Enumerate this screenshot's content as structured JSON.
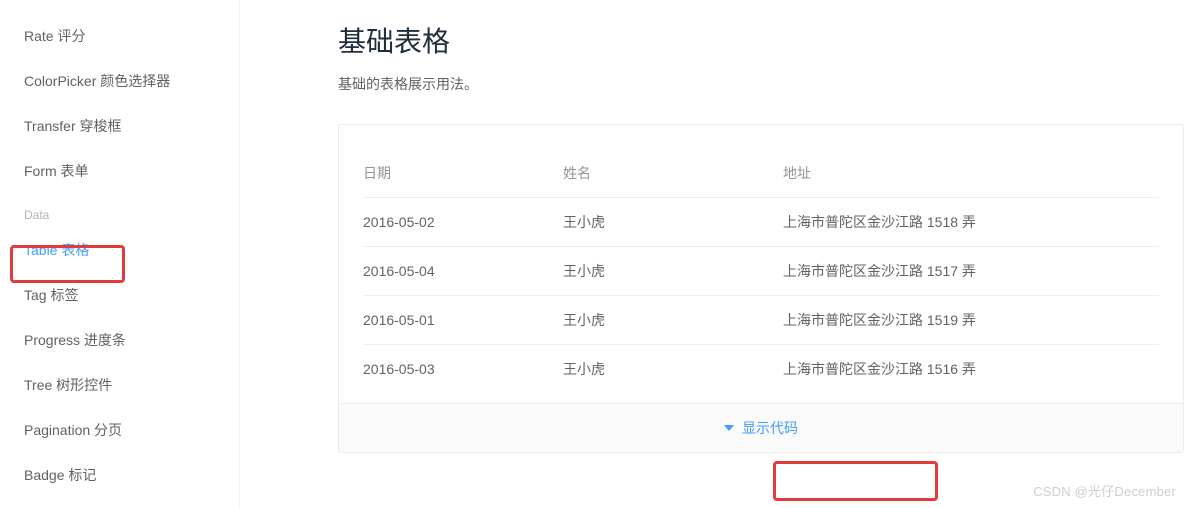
{
  "sidebar": {
    "items_top": [
      "Rate 评分",
      "ColorPicker 颜色选择器",
      "Transfer 穿梭框",
      "Form 表单"
    ],
    "group_title": "Data",
    "items_data": [
      "Table 表格",
      "Tag 标签",
      "Progress 进度条",
      "Tree 树形控件",
      "Pagination 分页",
      "Badge 标记"
    ]
  },
  "main": {
    "title": "基础表格",
    "desc": "基础的表格展示用法。",
    "headers": {
      "date": "日期",
      "name": "姓名",
      "address": "地址"
    },
    "rows": [
      {
        "date": "2016-05-02",
        "name": "王小虎",
        "address": "上海市普陀区金沙江路 1518 弄"
      },
      {
        "date": "2016-05-04",
        "name": "王小虎",
        "address": "上海市普陀区金沙江路 1517 弄"
      },
      {
        "date": "2016-05-01",
        "name": "王小虎",
        "address": "上海市普陀区金沙江路 1519 弄"
      },
      {
        "date": "2016-05-03",
        "name": "王小虎",
        "address": "上海市普陀区金沙江路 1516 弄"
      }
    ],
    "show_code": "显示代码"
  },
  "watermark": "CSDN @光仔December"
}
